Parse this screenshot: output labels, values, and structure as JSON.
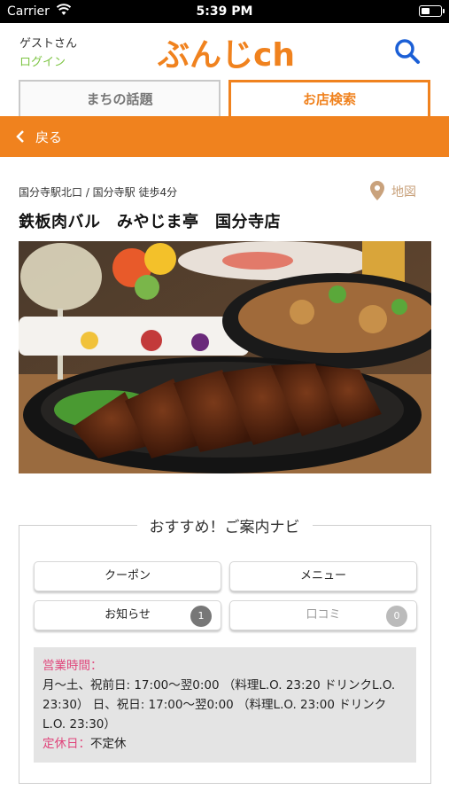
{
  "status_bar": {
    "carrier": "Carrier",
    "time": "5:39 PM"
  },
  "header": {
    "guest": "ゲストさん",
    "login": "ログイン",
    "logo_text": "ぶんじch",
    "brand_color": "#f0821e",
    "search_icon": "search-icon"
  },
  "tabs": [
    {
      "label": "まちの話題",
      "active": false
    },
    {
      "label": "お店検索",
      "active": true
    }
  ],
  "back_bar": {
    "label": "戻る",
    "icon": "chevron-left-icon"
  },
  "shop": {
    "station": "国分寺駅北口 / 国分寺駅 徒歩4分",
    "map_label": "地図",
    "map_icon": "map-pin-icon",
    "name": "鉄板肉バル　みやじま亭　国分寺店"
  },
  "navi": {
    "title": "おすすめ！ご案内ナビ",
    "buttons": {
      "coupon": "クーポン",
      "menu": "メニュー",
      "news": "お知らせ",
      "news_count": "1",
      "review": "口コミ",
      "review_count": "0"
    },
    "hours_label": "営業時間：",
    "hours_line1": "月〜土、祝前日: 17:00〜翌0:00 （料理L.O. 23:20 ドリンクL.O.",
    "hours_line2": "23:30） 日、祝日: 17:00〜翌0:00 （料理L.O. 23:00 ドリンク",
    "hours_line3": "L.O. 23:30）",
    "holiday_label": "定休日：",
    "holiday_value": "不定休"
  }
}
